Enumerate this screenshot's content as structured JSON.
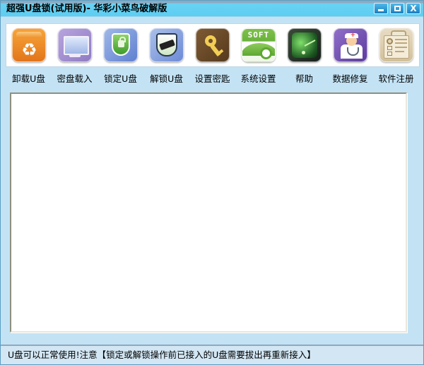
{
  "window": {
    "title": "超强U盘锁(试用版)- 华彩小菜鸟破解版",
    "controls": {
      "minimize": "minimize-button",
      "maximize": "maximize-button",
      "close": "X"
    },
    "accent_color": "#5ccdf2",
    "frame_color": "#c3e3f5"
  },
  "toolbar": {
    "items": [
      {
        "label": "卸载U盘",
        "icon": "recycle-bin-icon"
      },
      {
        "label": "密盘载入",
        "icon": "monitor-icon"
      },
      {
        "label": "锁定U盘",
        "icon": "shield-lock-icon"
      },
      {
        "label": "解锁U盘",
        "icon": "usb-shield-icon"
      },
      {
        "label": "设置密匙",
        "icon": "key-icon"
      },
      {
        "label": "系统设置",
        "icon": "soft-gear-icon"
      },
      {
        "label": "帮助",
        "icon": "radar-icon"
      },
      {
        "label": "数据修复",
        "icon": "doctor-icon"
      },
      {
        "label": "软件注册",
        "icon": "clipboard-register-icon"
      }
    ],
    "soft_icon_text": "SOFT"
  },
  "content": {
    "body_text": ""
  },
  "statusbar": {
    "text": "U盘可以正常使用!注意【锁定或解锁操作前已接入的U盘需要拔出再重新接入】"
  }
}
